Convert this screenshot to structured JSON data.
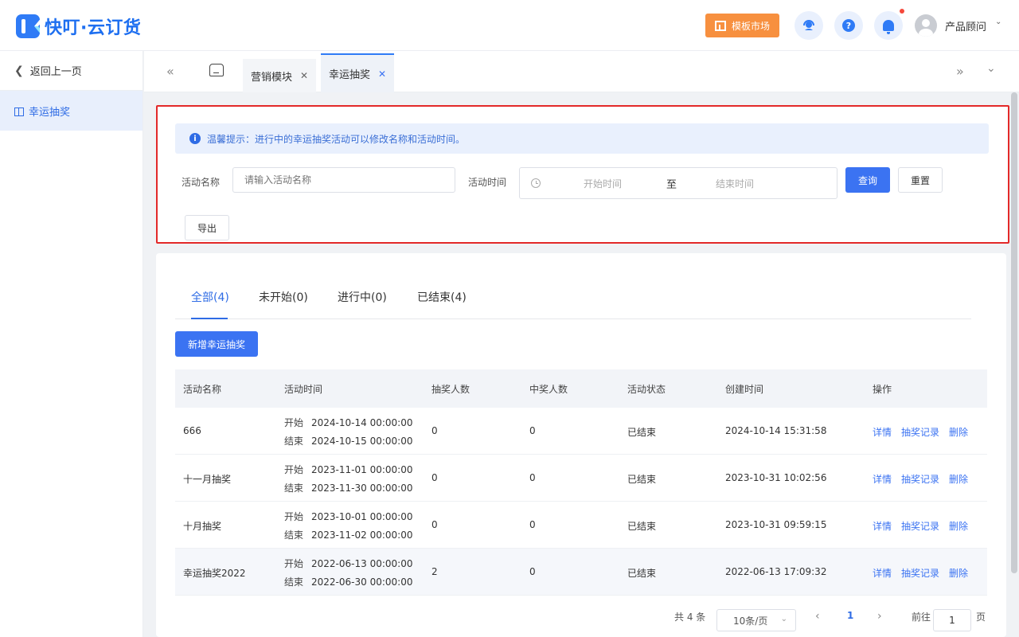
{
  "app": {
    "logo_text": "快叮·云订货"
  },
  "header": {
    "market_button": "模板市场",
    "help_glyph": "?",
    "user_name": "产品顾问"
  },
  "sidebar": {
    "back_label": "返回上一页",
    "items": [
      {
        "label": "幸运抽奖",
        "icon": "gift-icon",
        "active": true
      }
    ]
  },
  "tabs": [
    {
      "label": "营销模块",
      "closable": true,
      "active": false
    },
    {
      "label": "幸运抽奖",
      "closable": true,
      "active": true
    }
  ],
  "filter": {
    "tip": "温馨提示：进行中的幸运抽奖活动可以修改名称和活动时间。",
    "name_label": "活动名称",
    "name_placeholder": "请输入活动名称",
    "time_label": "活动时间",
    "start_placeholder": "开始时间",
    "range_separator": "至",
    "end_placeholder": "结束时间",
    "query_button": "查询",
    "reset_button": "重置",
    "export_button": "导出"
  },
  "status_tabs": [
    {
      "label": "全部(4)",
      "active": true
    },
    {
      "label": "未开始(0)",
      "active": false
    },
    {
      "label": "进行中(0)",
      "active": false
    },
    {
      "label": "已结束(4)",
      "active": false
    }
  ],
  "add_button": "新增幸运抽奖",
  "table": {
    "columns": [
      "活动名称",
      "活动时间",
      "抽奖人数",
      "中奖人数",
      "活动状态",
      "创建时间",
      "操作"
    ],
    "start_key": "开始",
    "end_key": "结束",
    "actions": [
      "详情",
      "抽奖记录",
      "删除"
    ],
    "rows": [
      {
        "name": "666",
        "start": "2024-10-14 00:00:00",
        "end": "2024-10-15 00:00:00",
        "draws": "0",
        "winners": "0",
        "status": "已结束",
        "created": "2024-10-14 15:31:58"
      },
      {
        "name": "十一月抽奖",
        "start": "2023-11-01 00:00:00",
        "end": "2023-11-30 00:00:00",
        "draws": "0",
        "winners": "0",
        "status": "已结束",
        "created": "2023-10-31 10:02:56"
      },
      {
        "name": "十月抽奖",
        "start": "2023-10-01 00:00:00",
        "end": "2023-11-02 00:00:00",
        "draws": "0",
        "winners": "0",
        "status": "已结束",
        "created": "2023-10-31 09:59:15"
      },
      {
        "name": "幸运抽奖2022",
        "start": "2022-06-13 00:00:00",
        "end": "2022-06-30 00:00:00",
        "draws": "2",
        "winners": "0",
        "status": "已结束",
        "created": "2022-06-13 17:09:32"
      }
    ]
  },
  "pagination": {
    "total_text": "共 4 条",
    "page_size": "10条/页",
    "current_page": "1",
    "goto_label": "前往",
    "goto_value": "1",
    "page_suffix": "页"
  },
  "colors": {
    "primary": "#3b73f2",
    "accent_orange": "#f7903f",
    "highlight_border": "#e32929"
  }
}
